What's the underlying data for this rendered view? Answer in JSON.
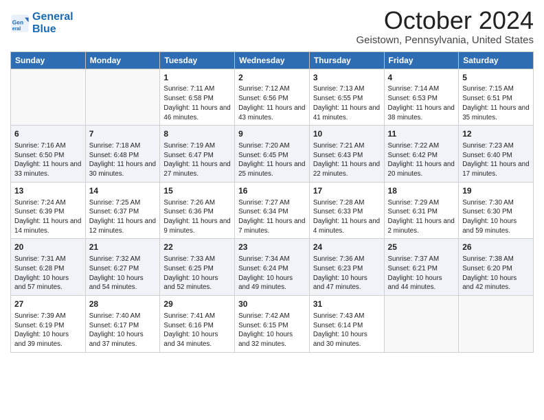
{
  "header": {
    "logo_line1": "General",
    "logo_line2": "Blue",
    "month_title": "October 2024",
    "location": "Geistown, Pennsylvania, United States"
  },
  "days_of_week": [
    "Sunday",
    "Monday",
    "Tuesday",
    "Wednesday",
    "Thursday",
    "Friday",
    "Saturday"
  ],
  "weeks": [
    [
      {
        "day": "",
        "info": ""
      },
      {
        "day": "",
        "info": ""
      },
      {
        "day": "1",
        "info": "Sunrise: 7:11 AM\nSunset: 6:58 PM\nDaylight: 11 hours and 46 minutes."
      },
      {
        "day": "2",
        "info": "Sunrise: 7:12 AM\nSunset: 6:56 PM\nDaylight: 11 hours and 43 minutes."
      },
      {
        "day": "3",
        "info": "Sunrise: 7:13 AM\nSunset: 6:55 PM\nDaylight: 11 hours and 41 minutes."
      },
      {
        "day": "4",
        "info": "Sunrise: 7:14 AM\nSunset: 6:53 PM\nDaylight: 11 hours and 38 minutes."
      },
      {
        "day": "5",
        "info": "Sunrise: 7:15 AM\nSunset: 6:51 PM\nDaylight: 11 hours and 35 minutes."
      }
    ],
    [
      {
        "day": "6",
        "info": "Sunrise: 7:16 AM\nSunset: 6:50 PM\nDaylight: 11 hours and 33 minutes."
      },
      {
        "day": "7",
        "info": "Sunrise: 7:18 AM\nSunset: 6:48 PM\nDaylight: 11 hours and 30 minutes."
      },
      {
        "day": "8",
        "info": "Sunrise: 7:19 AM\nSunset: 6:47 PM\nDaylight: 11 hours and 27 minutes."
      },
      {
        "day": "9",
        "info": "Sunrise: 7:20 AM\nSunset: 6:45 PM\nDaylight: 11 hours and 25 minutes."
      },
      {
        "day": "10",
        "info": "Sunrise: 7:21 AM\nSunset: 6:43 PM\nDaylight: 11 hours and 22 minutes."
      },
      {
        "day": "11",
        "info": "Sunrise: 7:22 AM\nSunset: 6:42 PM\nDaylight: 11 hours and 20 minutes."
      },
      {
        "day": "12",
        "info": "Sunrise: 7:23 AM\nSunset: 6:40 PM\nDaylight: 11 hours and 17 minutes."
      }
    ],
    [
      {
        "day": "13",
        "info": "Sunrise: 7:24 AM\nSunset: 6:39 PM\nDaylight: 11 hours and 14 minutes."
      },
      {
        "day": "14",
        "info": "Sunrise: 7:25 AM\nSunset: 6:37 PM\nDaylight: 11 hours and 12 minutes."
      },
      {
        "day": "15",
        "info": "Sunrise: 7:26 AM\nSunset: 6:36 PM\nDaylight: 11 hours and 9 minutes."
      },
      {
        "day": "16",
        "info": "Sunrise: 7:27 AM\nSunset: 6:34 PM\nDaylight: 11 hours and 7 minutes."
      },
      {
        "day": "17",
        "info": "Sunrise: 7:28 AM\nSunset: 6:33 PM\nDaylight: 11 hours and 4 minutes."
      },
      {
        "day": "18",
        "info": "Sunrise: 7:29 AM\nSunset: 6:31 PM\nDaylight: 11 hours and 2 minutes."
      },
      {
        "day": "19",
        "info": "Sunrise: 7:30 AM\nSunset: 6:30 PM\nDaylight: 10 hours and 59 minutes."
      }
    ],
    [
      {
        "day": "20",
        "info": "Sunrise: 7:31 AM\nSunset: 6:28 PM\nDaylight: 10 hours and 57 minutes."
      },
      {
        "day": "21",
        "info": "Sunrise: 7:32 AM\nSunset: 6:27 PM\nDaylight: 10 hours and 54 minutes."
      },
      {
        "day": "22",
        "info": "Sunrise: 7:33 AM\nSunset: 6:25 PM\nDaylight: 10 hours and 52 minutes."
      },
      {
        "day": "23",
        "info": "Sunrise: 7:34 AM\nSunset: 6:24 PM\nDaylight: 10 hours and 49 minutes."
      },
      {
        "day": "24",
        "info": "Sunrise: 7:36 AM\nSunset: 6:23 PM\nDaylight: 10 hours and 47 minutes."
      },
      {
        "day": "25",
        "info": "Sunrise: 7:37 AM\nSunset: 6:21 PM\nDaylight: 10 hours and 44 minutes."
      },
      {
        "day": "26",
        "info": "Sunrise: 7:38 AM\nSunset: 6:20 PM\nDaylight: 10 hours and 42 minutes."
      }
    ],
    [
      {
        "day": "27",
        "info": "Sunrise: 7:39 AM\nSunset: 6:19 PM\nDaylight: 10 hours and 39 minutes."
      },
      {
        "day": "28",
        "info": "Sunrise: 7:40 AM\nSunset: 6:17 PM\nDaylight: 10 hours and 37 minutes."
      },
      {
        "day": "29",
        "info": "Sunrise: 7:41 AM\nSunset: 6:16 PM\nDaylight: 10 hours and 34 minutes."
      },
      {
        "day": "30",
        "info": "Sunrise: 7:42 AM\nSunset: 6:15 PM\nDaylight: 10 hours and 32 minutes."
      },
      {
        "day": "31",
        "info": "Sunrise: 7:43 AM\nSunset: 6:14 PM\nDaylight: 10 hours and 30 minutes."
      },
      {
        "day": "",
        "info": ""
      },
      {
        "day": "",
        "info": ""
      }
    ]
  ]
}
